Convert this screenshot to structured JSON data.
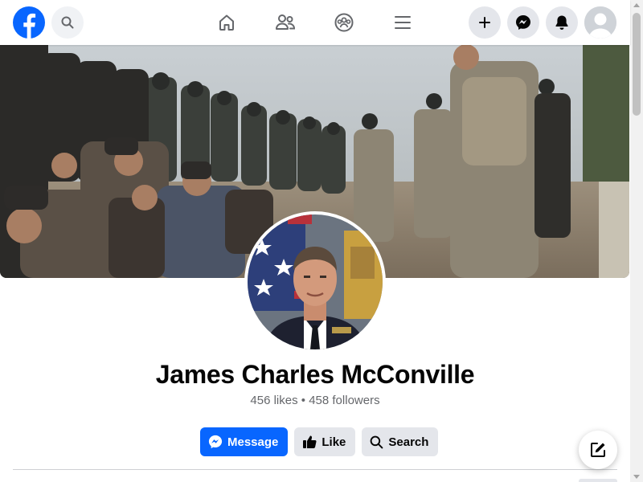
{
  "app": {
    "brand": "facebook",
    "accent_color": "#0866ff"
  },
  "topbar": {
    "icons": [
      "facebook-logo-icon",
      "search-icon",
      "home-icon",
      "friends-icon",
      "groups-icon",
      "menu-icon",
      "create-icon",
      "messenger-icon",
      "notifications-icon",
      "account-avatar"
    ]
  },
  "profile": {
    "name": "James Charles McConville",
    "stats": "456 likes • 458 followers"
  },
  "actions": {
    "message_label": "Message",
    "like_label": "Like",
    "search_label": "Search"
  }
}
